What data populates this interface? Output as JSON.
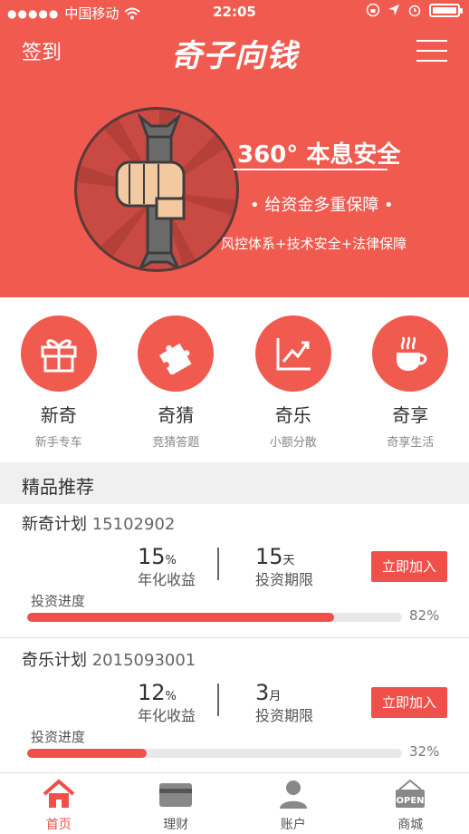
{
  "status_bar": {
    "carrier": "中国移动",
    "time": "22:05"
  },
  "header": {
    "checkin": "签到",
    "logo": "奇子向钱"
  },
  "hero": {
    "title": "360° 本息安全",
    "subtitle": "• 给资金多重保障 •",
    "description": "风控体系+技术安全+法律保障"
  },
  "entries": [
    {
      "name": "新奇",
      "desc": "新手专车",
      "icon": "gift-icon"
    },
    {
      "name": "奇猜",
      "desc": "竞猜答题",
      "icon": "puzzle-icon"
    },
    {
      "name": "奇乐",
      "desc": "小额分散",
      "icon": "chart-icon"
    },
    {
      "name": "奇享",
      "desc": "奇享生活",
      "icon": "coffee-icon"
    }
  ],
  "section_title": "精品推荐",
  "products": [
    {
      "name": "新奇计划",
      "code": "15102902",
      "rate": "15",
      "rate_unit": "%",
      "rate_label": "年化收益",
      "term": "15",
      "term_unit": "天",
      "term_label": "投资期限",
      "button": "立即加入",
      "progress_label": "投资进度",
      "progress": 82,
      "progress_text": "82%"
    },
    {
      "name": "奇乐计划",
      "code": "2015093001",
      "rate": "12",
      "rate_unit": "%",
      "rate_label": "年化收益",
      "term": "3",
      "term_unit": "月",
      "term_label": "投资期限",
      "button": "立即加入",
      "progress_label": "投资进度",
      "progress": 32,
      "progress_text": "32%"
    }
  ],
  "tabs": [
    {
      "label": "首页",
      "icon": "home-icon",
      "active": true
    },
    {
      "label": "理财",
      "icon": "card-icon",
      "active": false
    },
    {
      "label": "账户",
      "icon": "user-icon",
      "active": false
    },
    {
      "label": "商城",
      "icon": "shop-open-icon",
      "sign": "OPEN",
      "active": false
    }
  ],
  "colors": {
    "brand": "#f05a4f",
    "inactive_tab": "#888888"
  }
}
